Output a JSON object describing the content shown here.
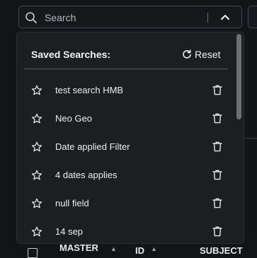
{
  "search": {
    "placeholder": "Search"
  },
  "saved_searches": {
    "title": "Saved Searches:",
    "reset_label": "Reset",
    "items": [
      {
        "label": "test search HMB"
      },
      {
        "label": "Neo Geo"
      },
      {
        "label": "Date applied Filter"
      },
      {
        "label": "4 dates applies"
      },
      {
        "label": "null field"
      },
      {
        "label": "14 sep"
      }
    ]
  },
  "table": {
    "columns": [
      {
        "label": "MASTER"
      },
      {
        "label": "ID"
      },
      {
        "label": "SUBJECT"
      }
    ]
  },
  "icons": {
    "search": "search-icon",
    "collapse": "chevron-up-icon",
    "reset": "refresh-icon",
    "star": "star-outline-icon",
    "delete": "trash-icon",
    "sort": "sort-up-icon"
  },
  "colors": {
    "background": "#131417",
    "panel": "#1d1e22",
    "text": "#e8e8ea",
    "border": "#43464d"
  }
}
